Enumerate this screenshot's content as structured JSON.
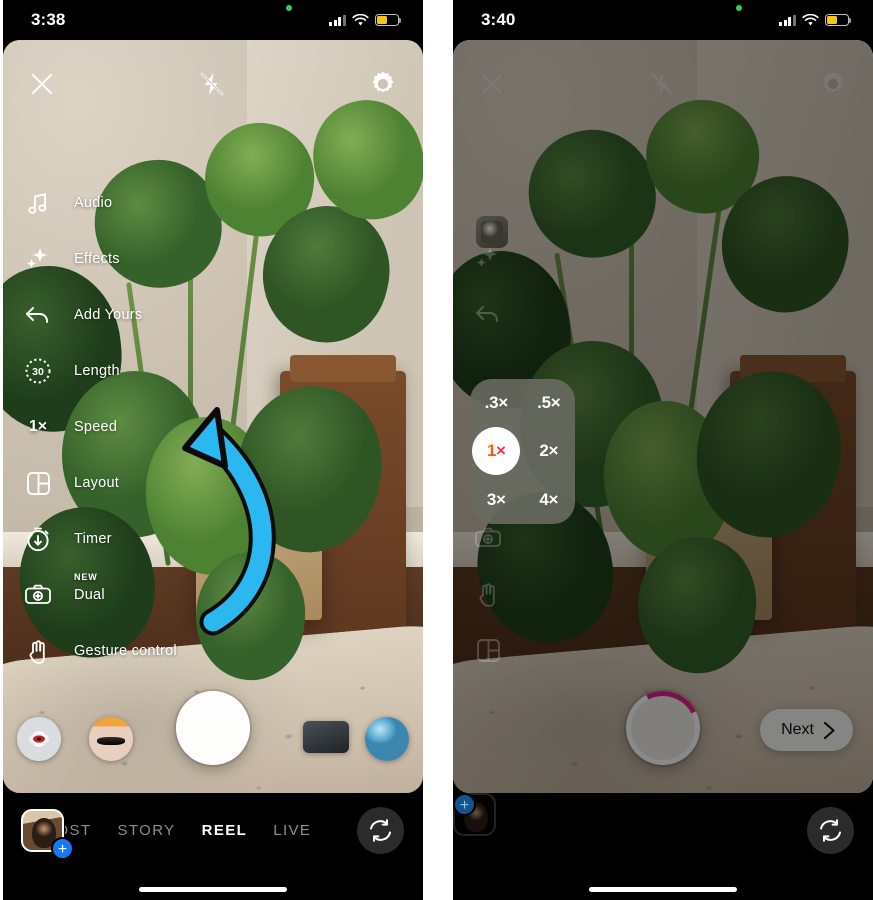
{
  "meta": {
    "accent_blue": "#1877f2",
    "arrow_color": "#2bb8f0",
    "record_arc": "#e0218a"
  },
  "left_phone": {
    "status": {
      "time": "3:38",
      "signal_icon": "cellular-bars-icon",
      "wifi_icon": "wifi-icon",
      "battery_icon": "battery-icon"
    },
    "camera_bar": {
      "close_label": "close-icon",
      "flash_label": "flash-off-icon",
      "settings_label": "settings-gear-icon"
    },
    "menu": [
      {
        "label": "Audio",
        "icon": "music-note-icon",
        "glyph": ""
      },
      {
        "label": "Effects",
        "icon": "sparkles-icon",
        "glyph": ""
      },
      {
        "label": "Add Yours",
        "icon": "reply-arrow-icon",
        "glyph": ""
      },
      {
        "label": "Length",
        "icon": "length-30-icon",
        "glyph": "30"
      },
      {
        "label": "Speed",
        "icon": "speed-1x-icon",
        "glyph": "1×"
      },
      {
        "label": "Layout",
        "icon": "layout-grid-icon",
        "glyph": ""
      },
      {
        "label": "Timer",
        "icon": "timer-icon",
        "glyph": ""
      },
      {
        "label": "Dual",
        "icon": "dual-camera-icon",
        "glyph": "",
        "badge": "NEW"
      },
      {
        "label": "Gesture control",
        "icon": "hand-icon",
        "glyph": ""
      }
    ],
    "effects": [
      {
        "name": "effect-thumb-eye"
      },
      {
        "name": "effect-thumb-face"
      },
      {
        "name": "effect-thumb-device"
      },
      {
        "name": "effect-thumb-blue-orb"
      }
    ],
    "shutter": {
      "name": "shutter-button",
      "recording": false
    },
    "tabbar": {
      "avatar": "profile-avatar",
      "add_badge": "+",
      "tabs": [
        {
          "label": "POST",
          "active": false,
          "clipped": true
        },
        {
          "label": "STORY",
          "active": false,
          "clipped": false
        },
        {
          "label": "REEL",
          "active": true,
          "clipped": false
        },
        {
          "label": "LIVE",
          "active": false,
          "clipped": false
        }
      ],
      "flip_icon": "camera-flip-icon"
    }
  },
  "right_phone": {
    "status": {
      "time": "3:40",
      "signal_icon": "cellular-bars-icon",
      "wifi_icon": "wifi-icon",
      "battery_icon": "battery-icon"
    },
    "camera_bar": {
      "close_label": "close-icon",
      "flash_label": "flash-off-icon",
      "settings_label": "settings-gear-icon"
    },
    "speed_popover": {
      "name": "speed-selector",
      "options": [
        {
          "label": ".3×",
          "selected": false
        },
        {
          "label": ".5×",
          "selected": false
        },
        {
          "label": "1×",
          "selected": true
        },
        {
          "label": "2×",
          "selected": false
        },
        {
          "label": "3×",
          "selected": false
        },
        {
          "label": "4×",
          "selected": false
        }
      ]
    },
    "dim_menu_icons": [
      "sparkles-icon",
      "reply-arrow-icon",
      "dual-camera-icon",
      "hand-icon",
      "layout-grid-icon"
    ],
    "shutter": {
      "name": "shutter-button",
      "recording": true
    },
    "next_button": {
      "label": "Next",
      "icon": "chevron-right-icon"
    },
    "tabbar": {
      "avatar": "profile-avatar",
      "add_badge": "+",
      "tabs": [],
      "flip_icon": "camera-flip-icon"
    }
  },
  "annotation": {
    "arrow": "curved-arrow-pointing-to-speed"
  }
}
